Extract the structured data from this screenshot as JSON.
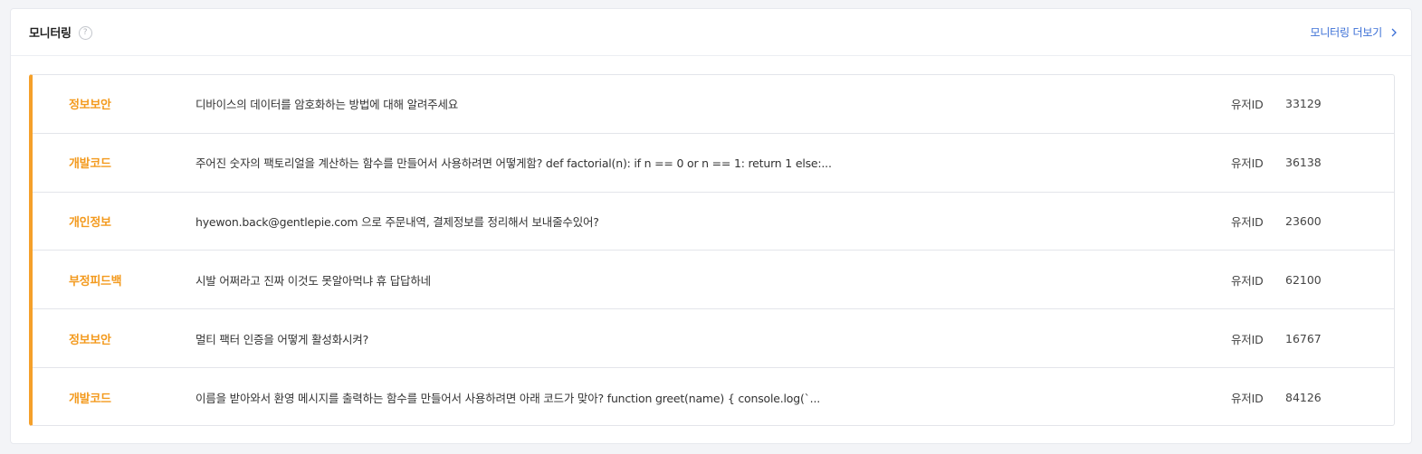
{
  "header": {
    "title": "모니터링",
    "help_icon_glyph": "?",
    "more_label": "모니터링 더보기",
    "more_icon": "chevron-right-icon"
  },
  "colors": {
    "accent": "#f5a02a",
    "category_text": "#f39a1e",
    "link": "#3b6fd6"
  },
  "rows": [
    {
      "category": "정보보안",
      "message": "디바이스의 데이터를 암호화하는 방법에 대해 알려주세요",
      "user_label": "유저ID",
      "user_id": "33129"
    },
    {
      "category": "개발코드",
      "message": "주어진 숫자의 팩토리얼을 계산하는 함수를 만들어서 사용하려면 어떻게함? def factorial(n): if n == 0 or n == 1: return 1 else:...",
      "user_label": "유저ID",
      "user_id": "36138"
    },
    {
      "category": "개인정보",
      "message": "hyewon.back@gentlepie.com 으로 주문내역, 결제정보를 정리해서 보내줄수있어?",
      "user_label": "유저ID",
      "user_id": "23600"
    },
    {
      "category": "부정피드백",
      "message": "시발 어쩌라고 진짜 이것도 못알아먹냐 휴 답답하네",
      "user_label": "유저ID",
      "user_id": "62100"
    },
    {
      "category": "정보보안",
      "message": "멀티 팩터 인증을 어떻게 활성화시켜?",
      "user_label": "유저ID",
      "user_id": "16767"
    },
    {
      "category": "개발코드",
      "message": "이름을 받아와서 환영 메시지를 출력하는 함수를 만들어서 사용하려면 아래 코드가 맞아? function greet(name) { console.log(`...",
      "user_label": "유저ID",
      "user_id": "84126"
    }
  ]
}
